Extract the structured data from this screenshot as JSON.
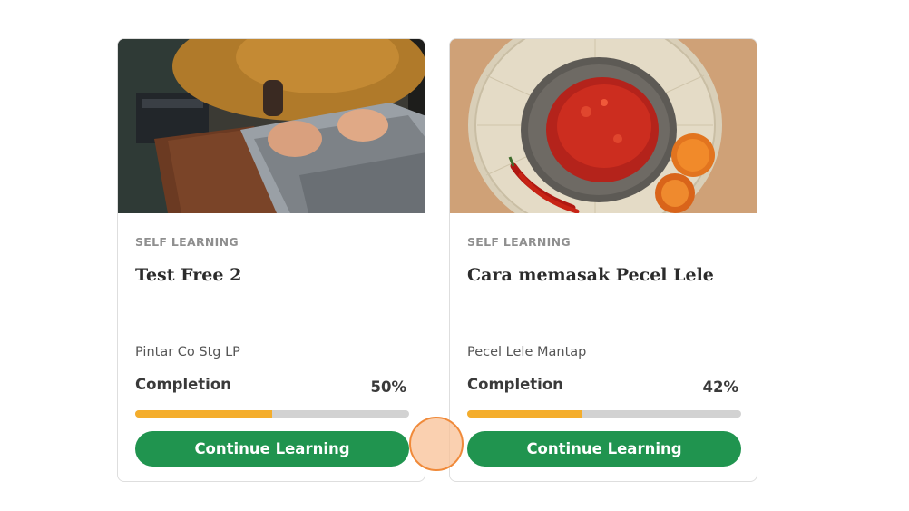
{
  "courses": [
    {
      "type": "SELF LEARNING",
      "title": "Test Free 2",
      "organization": "Pintar Co Stg LP",
      "completion_label": "Completion",
      "completion_percent": "50%",
      "progress": 0.5,
      "button_label": "Continue Learning",
      "image": "laptop-typing-photo"
    },
    {
      "type": "SELF LEARNING",
      "title": "Cara memasak Pecel Lele",
      "organization": "Pecel Lele Mantap",
      "completion_label": "Completion",
      "completion_percent": "42%",
      "progress": 0.42,
      "button_label": "Continue Learning",
      "image": "sambal-mortar-photo"
    }
  ],
  "colors": {
    "button": "#20944f",
    "progress_fill": "#f4ad2b",
    "progress_track": "#d2d2d2",
    "click_indicator": "#f08a3a"
  }
}
